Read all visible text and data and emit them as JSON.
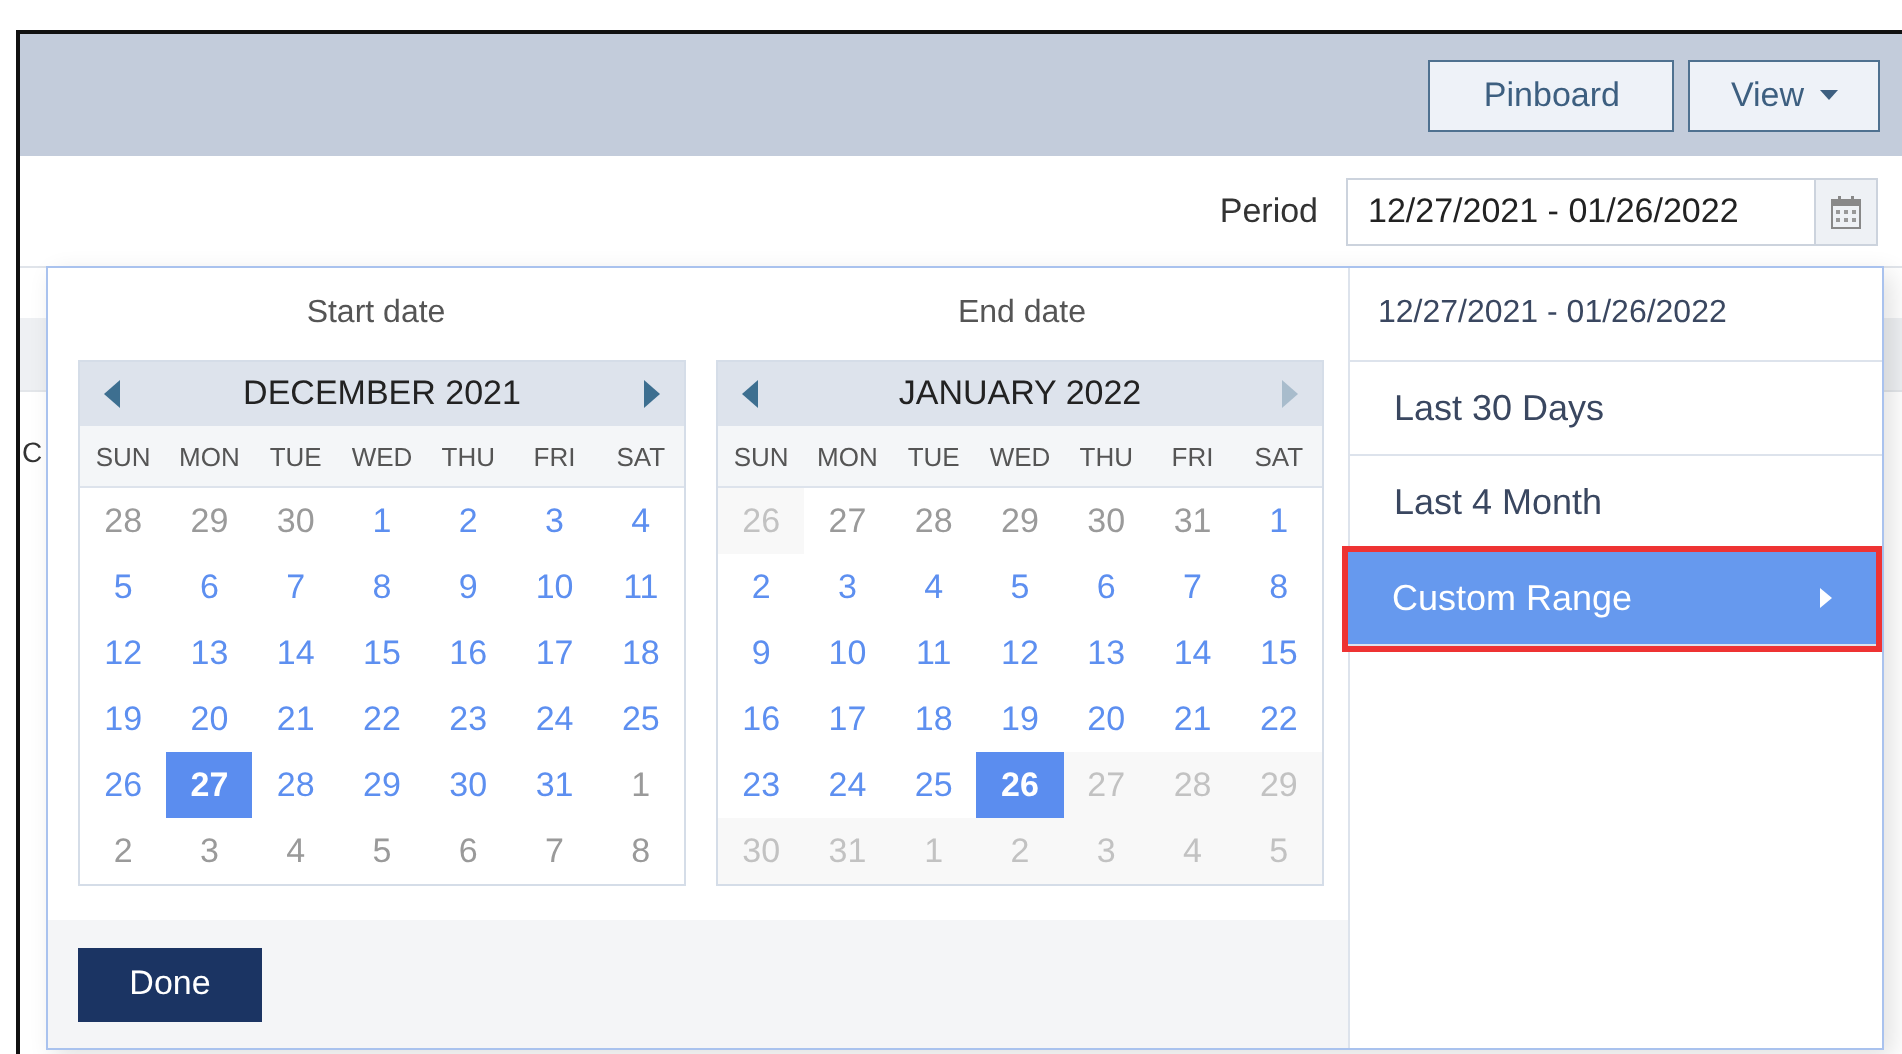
{
  "toolbar": {
    "buttons": [
      {
        "label": "Pinboard",
        "kind": "plain"
      },
      {
        "label": "View",
        "kind": "dropdown"
      }
    ]
  },
  "period": {
    "label": "Period",
    "value": "12/27/2021 - 01/26/2022"
  },
  "background_text": "C",
  "picker": {
    "start_label": "Start date",
    "end_label": "End date",
    "calendars": [
      {
        "title": "DECEMBER 2021",
        "prev_disabled": false,
        "next_disabled": false,
        "weekdays": [
          "SUN",
          "MON",
          "TUE",
          "WED",
          "THU",
          "FRI",
          "SAT"
        ],
        "weeks": [
          [
            {
              "d": "28",
              "kind": "other",
              "selected": false
            },
            {
              "d": "29",
              "kind": "other",
              "selected": false
            },
            {
              "d": "30",
              "kind": "other",
              "selected": false
            },
            {
              "d": "1",
              "kind": "in",
              "selected": false
            },
            {
              "d": "2",
              "kind": "in",
              "selected": false
            },
            {
              "d": "3",
              "kind": "in",
              "selected": false
            },
            {
              "d": "4",
              "kind": "in",
              "selected": false
            }
          ],
          [
            {
              "d": "5",
              "kind": "in",
              "selected": false
            },
            {
              "d": "6",
              "kind": "in",
              "selected": false
            },
            {
              "d": "7",
              "kind": "in",
              "selected": false
            },
            {
              "d": "8",
              "kind": "in",
              "selected": false
            },
            {
              "d": "9",
              "kind": "in",
              "selected": false
            },
            {
              "d": "10",
              "kind": "in",
              "selected": false
            },
            {
              "d": "11",
              "kind": "in",
              "selected": false
            }
          ],
          [
            {
              "d": "12",
              "kind": "in",
              "selected": false
            },
            {
              "d": "13",
              "kind": "in",
              "selected": false
            },
            {
              "d": "14",
              "kind": "in",
              "selected": false
            },
            {
              "d": "15",
              "kind": "in",
              "selected": false
            },
            {
              "d": "16",
              "kind": "in",
              "selected": false
            },
            {
              "d": "17",
              "kind": "in",
              "selected": false
            },
            {
              "d": "18",
              "kind": "in",
              "selected": false
            }
          ],
          [
            {
              "d": "19",
              "kind": "in",
              "selected": false
            },
            {
              "d": "20",
              "kind": "in",
              "selected": false
            },
            {
              "d": "21",
              "kind": "in",
              "selected": false
            },
            {
              "d": "22",
              "kind": "in",
              "selected": false
            },
            {
              "d": "23",
              "kind": "in",
              "selected": false
            },
            {
              "d": "24",
              "kind": "in",
              "selected": false
            },
            {
              "d": "25",
              "kind": "in",
              "selected": false
            }
          ],
          [
            {
              "d": "26",
              "kind": "in",
              "selected": false
            },
            {
              "d": "27",
              "kind": "in",
              "selected": true
            },
            {
              "d": "28",
              "kind": "in",
              "selected": false
            },
            {
              "d": "29",
              "kind": "in",
              "selected": false
            },
            {
              "d": "30",
              "kind": "in",
              "selected": false
            },
            {
              "d": "31",
              "kind": "in",
              "selected": false
            },
            {
              "d": "1",
              "kind": "other",
              "selected": false
            }
          ],
          [
            {
              "d": "2",
              "kind": "other",
              "selected": false
            },
            {
              "d": "3",
              "kind": "other",
              "selected": false
            },
            {
              "d": "4",
              "kind": "other",
              "selected": false
            },
            {
              "d": "5",
              "kind": "other",
              "selected": false
            },
            {
              "d": "6",
              "kind": "other",
              "selected": false
            },
            {
              "d": "7",
              "kind": "other",
              "selected": false
            },
            {
              "d": "8",
              "kind": "other",
              "selected": false
            }
          ]
        ]
      },
      {
        "title": "JANUARY 2022",
        "prev_disabled": false,
        "next_disabled": true,
        "weekdays": [
          "SUN",
          "MON",
          "TUE",
          "WED",
          "THU",
          "FRI",
          "SAT"
        ],
        "weeks": [
          [
            {
              "d": "26",
              "kind": "disabled",
              "selected": false
            },
            {
              "d": "27",
              "kind": "other",
              "selected": false
            },
            {
              "d": "28",
              "kind": "other",
              "selected": false
            },
            {
              "d": "29",
              "kind": "other",
              "selected": false
            },
            {
              "d": "30",
              "kind": "other",
              "selected": false
            },
            {
              "d": "31",
              "kind": "other",
              "selected": false
            },
            {
              "d": "1",
              "kind": "in",
              "selected": false
            }
          ],
          [
            {
              "d": "2",
              "kind": "in",
              "selected": false
            },
            {
              "d": "3",
              "kind": "in",
              "selected": false
            },
            {
              "d": "4",
              "kind": "in",
              "selected": false
            },
            {
              "d": "5",
              "kind": "in",
              "selected": false
            },
            {
              "d": "6",
              "kind": "in",
              "selected": false
            },
            {
              "d": "7",
              "kind": "in",
              "selected": false
            },
            {
              "d": "8",
              "kind": "in",
              "selected": false
            }
          ],
          [
            {
              "d": "9",
              "kind": "in",
              "selected": false
            },
            {
              "d": "10",
              "kind": "in",
              "selected": false
            },
            {
              "d": "11",
              "kind": "in",
              "selected": false
            },
            {
              "d": "12",
              "kind": "in",
              "selected": false
            },
            {
              "d": "13",
              "kind": "in",
              "selected": false
            },
            {
              "d": "14",
              "kind": "in",
              "selected": false
            },
            {
              "d": "15",
              "kind": "in",
              "selected": false
            }
          ],
          [
            {
              "d": "16",
              "kind": "in",
              "selected": false
            },
            {
              "d": "17",
              "kind": "in",
              "selected": false
            },
            {
              "d": "18",
              "kind": "in",
              "selected": false
            },
            {
              "d": "19",
              "kind": "in",
              "selected": false
            },
            {
              "d": "20",
              "kind": "in",
              "selected": false
            },
            {
              "d": "21",
              "kind": "in",
              "selected": false
            },
            {
              "d": "22",
              "kind": "in",
              "selected": false
            }
          ],
          [
            {
              "d": "23",
              "kind": "in",
              "selected": false
            },
            {
              "d": "24",
              "kind": "in",
              "selected": false
            },
            {
              "d": "25",
              "kind": "in",
              "selected": false
            },
            {
              "d": "26",
              "kind": "in",
              "selected": true
            },
            {
              "d": "27",
              "kind": "disabled",
              "selected": false
            },
            {
              "d": "28",
              "kind": "disabled",
              "selected": false
            },
            {
              "d": "29",
              "kind": "disabled",
              "selected": false
            }
          ],
          [
            {
              "d": "30",
              "kind": "disabled",
              "selected": false
            },
            {
              "d": "31",
              "kind": "disabled",
              "selected": false
            },
            {
              "d": "1",
              "kind": "disabled",
              "selected": false
            },
            {
              "d": "2",
              "kind": "disabled",
              "selected": false
            },
            {
              "d": "3",
              "kind": "disabled",
              "selected": false
            },
            {
              "d": "4",
              "kind": "disabled",
              "selected": false
            },
            {
              "d": "5",
              "kind": "disabled",
              "selected": false
            }
          ]
        ]
      }
    ],
    "done": "Done",
    "ranges": [
      {
        "label": "12/27/2021 - 01/26/2022",
        "kind": "current",
        "selected": false,
        "has_submenu": false,
        "highlighted": false
      },
      {
        "label": "Last 30 Days",
        "kind": "option",
        "selected": false,
        "has_submenu": false,
        "highlighted": false
      },
      {
        "label": "Last 4 Month",
        "kind": "option",
        "selected": false,
        "has_submenu": false,
        "highlighted": false
      },
      {
        "label": "Custom Range",
        "kind": "option",
        "selected": true,
        "has_submenu": true,
        "highlighted": true
      }
    ]
  }
}
